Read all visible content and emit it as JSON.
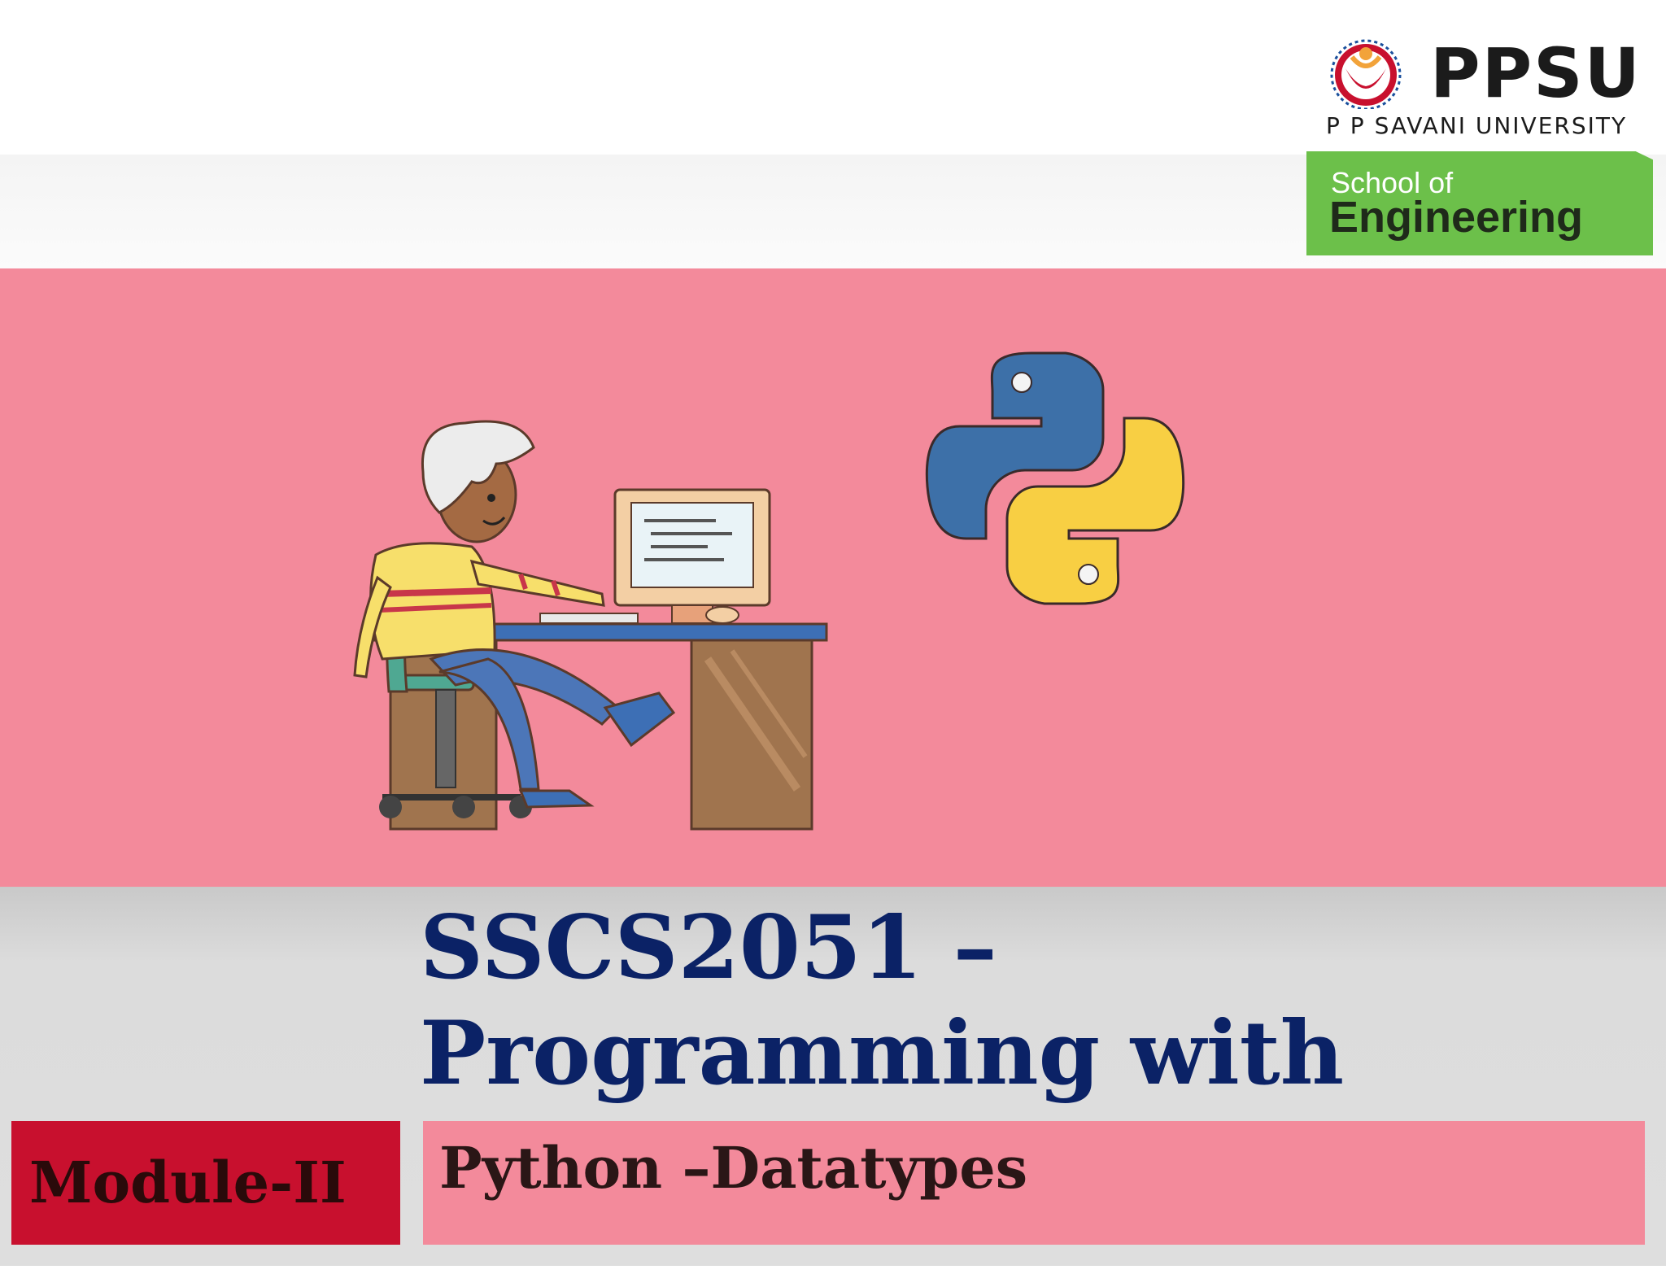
{
  "logo": {
    "name": "PPSU",
    "full_name": "P P SAVANI UNIVERSITY",
    "school_line1": "School of",
    "school_line2": "Engineering"
  },
  "course": {
    "title": "SSCS2051 – Programming with Python"
  },
  "module": {
    "label": "Module-II",
    "topic": "Python –Datatypes"
  },
  "colors": {
    "hero_background": "#f38a9b",
    "title_color": "#0b2266",
    "module_box": "#c8102e",
    "badge_green": "#6cc04a"
  },
  "illustrations": [
    "programmer-at-desk-illustration",
    "python-logo-icon"
  ]
}
